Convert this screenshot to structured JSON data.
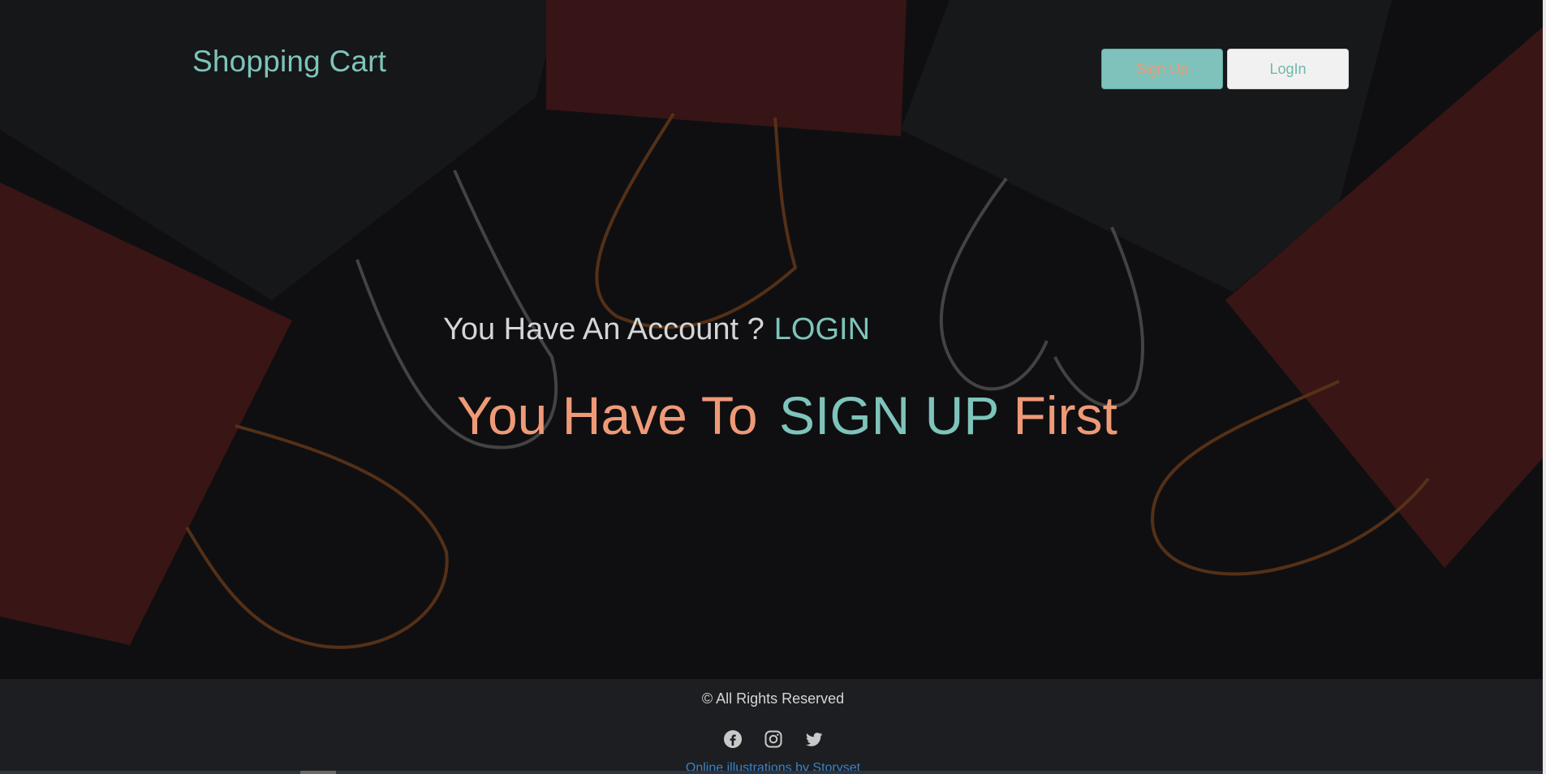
{
  "header": {
    "brand": "Shopping Cart",
    "signup_label": "Sign Up",
    "login_label": "LogIn"
  },
  "main": {
    "prompt_text": "You Have An Account ?",
    "prompt_link": "LOGIN",
    "headline_pre": "You Have To",
    "headline_accent": "SIGN UP",
    "headline_post": "First"
  },
  "footer": {
    "copyright": "© All Rights Reserved",
    "social_icons": [
      "facebook-icon",
      "instagram-icon",
      "twitter-icon"
    ],
    "credit_link": "Online illustrations by Storyset"
  },
  "colors": {
    "teal": "#7ec4bb",
    "salmon": "#ef9a77",
    "background": "#141518",
    "footer": "#1c1e21"
  }
}
